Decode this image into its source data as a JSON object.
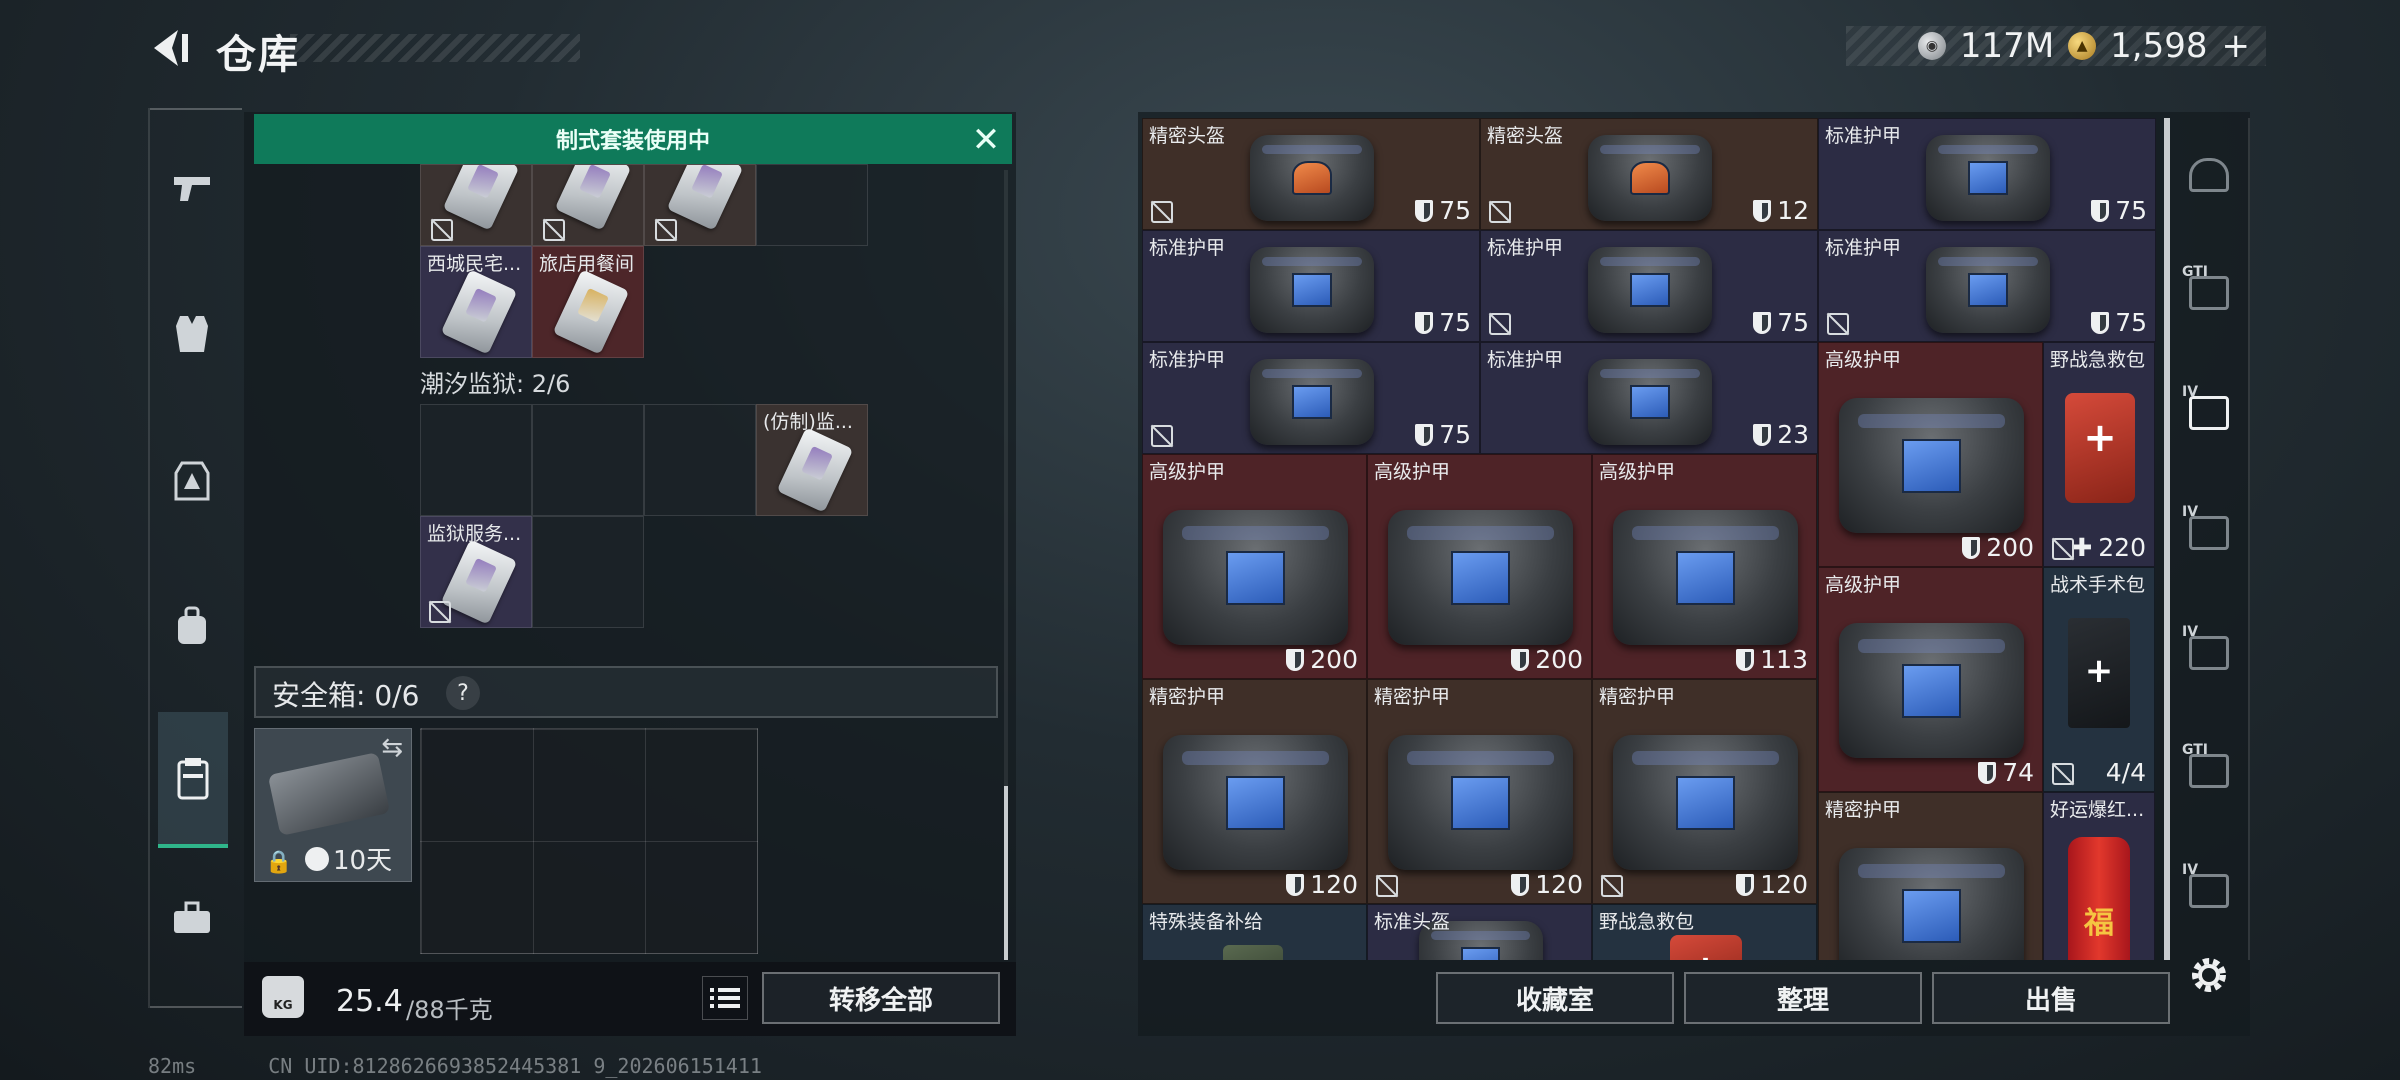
{
  "header": {
    "title": "仓库"
  },
  "currency": {
    "silver": "117M",
    "gold": "1,598",
    "gold_add": "+"
  },
  "left_nav": [
    "weapon-tab",
    "vest-tab",
    "armor-tab",
    "backpack-tab",
    "container-tab",
    "toolbox-tab"
  ],
  "kit_banner": "制式套装使用中",
  "left_grid": {
    "items": [
      {
        "label": "西城民宅...",
        "color": "purple"
      },
      {
        "label": "旅店用餐间",
        "color": "red"
      }
    ],
    "prison_label": "潮汐监狱: 2/6",
    "prison_items": [
      {
        "label": "(仿制)监..."
      },
      {
        "label": "监狱服务..."
      }
    ]
  },
  "safe_box": {
    "label": "安全箱: 0/6",
    "help": "?",
    "duration": "10天"
  },
  "weight": {
    "current": "25.4",
    "max": "/88千克",
    "icon_text": "KG"
  },
  "buttons": {
    "transfer_all": "转移全部",
    "collection": "收藏室",
    "organize": "整理",
    "sell": "出售"
  },
  "status": {
    "ping": "82ms",
    "uid": "CN UID:8128626693852445381 9_202606151411"
  },
  "inventory": [
    {
      "label": "精密头盔",
      "durability": "75",
      "color": "brown"
    },
    {
      "label": "精密头盔",
      "durability": "12",
      "color": "brown"
    },
    {
      "label": "标准护甲",
      "durability": "75",
      "color": "purple"
    },
    {
      "label": "标准护甲",
      "durability": "75",
      "color": "purple"
    },
    {
      "label": "标准护甲",
      "durability": "75",
      "color": "purple"
    },
    {
      "label": "标准护甲",
      "durability": "75",
      "color": "purple"
    },
    {
      "label": "标准护甲",
      "durability": "75",
      "color": "purple"
    },
    {
      "label": "标准护甲",
      "durability": "23",
      "color": "purple"
    },
    {
      "label": "高级护甲",
      "durability": "200",
      "color": "red"
    },
    {
      "label": "野战急救包",
      "durability": "220",
      "color": "purple"
    },
    {
      "label": "高级护甲",
      "durability": "200",
      "color": "red"
    },
    {
      "label": "高级护甲",
      "durability": "200",
      "color": "red"
    },
    {
      "label": "高级护甲",
      "durability": "113",
      "color": "red"
    },
    {
      "label": "高级护甲",
      "durability": "74",
      "color": "red"
    },
    {
      "label": "战术手术包",
      "durability": "4/4",
      "color": "blue"
    },
    {
      "label": "精密护甲",
      "durability": "120",
      "color": "brown"
    },
    {
      "label": "精密护甲",
      "durability": "120",
      "color": "brown"
    },
    {
      "label": "精密护甲",
      "durability": "120",
      "color": "brown"
    },
    {
      "label": "精密护甲",
      "durability": "",
      "color": "brown"
    },
    {
      "label": "好运爆红...",
      "durability": "",
      "color": "purple"
    },
    {
      "label": "特殊装备补给",
      "durability": "",
      "color": "blue"
    },
    {
      "label": "标准头盔",
      "durability": "",
      "color": "purple"
    },
    {
      "label": "野战急救包",
      "durability": "",
      "color": "blue"
    }
  ],
  "right_nav": [
    {
      "tier": "",
      "name": "helmet-tab"
    },
    {
      "tier": "GTI",
      "name": "gun-tier-tab"
    },
    {
      "tier": "IV",
      "name": "medkit-tier-tab"
    },
    {
      "tier": "IV",
      "name": "folder-tier4-tab-a"
    },
    {
      "tier": "IV",
      "name": "folder-tier4-tab-b"
    },
    {
      "tier": "GTI",
      "name": "armor-tier-tab"
    },
    {
      "tier": "IV",
      "name": "armor-tier4-tab"
    }
  ],
  "colors": {
    "brown": "#3f2f28",
    "purple": "#2c2c44",
    "red": "#4e2327",
    "blue": "#243240",
    "accent": "#0f7a5a"
  }
}
